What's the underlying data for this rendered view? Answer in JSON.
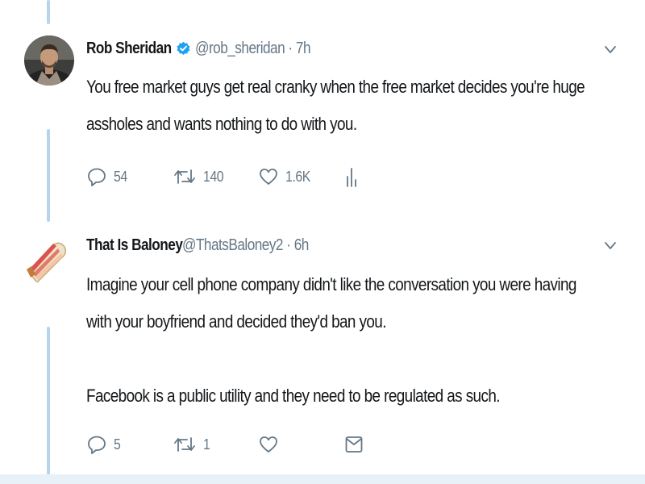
{
  "tweets": [
    {
      "name": "Rob Sheridan",
      "verified": true,
      "handle": "@rob_sheridan · 7h",
      "text_lines": [
        "You free market guys get real cranky when the free market decides you're huge",
        "assholes and wants nothing to do with you."
      ],
      "replies": "54",
      "retweets": "140",
      "likes": "1.6K",
      "extra_action_icon": "analytics-icon"
    },
    {
      "name": "That Is Baloney",
      "verified": false,
      "handle": "@ThatsBaloney2 · 6h",
      "text_lines": [
        "Imagine your cell phone company didn't like the conversation you were having",
        "with your boyfriend and decided they'd ban you.",
        "",
        "Facebook is a public utility and they need to be regulated as such."
      ],
      "replies": "5",
      "retweets": "1",
      "likes": "",
      "extra_action_icon": "direct-message-icon"
    }
  ],
  "colors": {
    "accent": "#1da1f2",
    "secondary_text": "#657786",
    "thread_line": "#b6d4ec"
  }
}
